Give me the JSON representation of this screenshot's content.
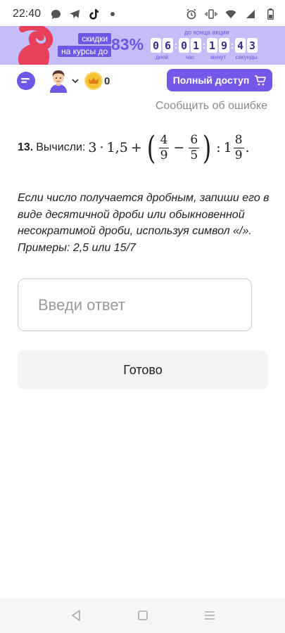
{
  "status_bar": {
    "time": "22:40",
    "icons_left": [
      "chat-bubble-icon",
      "telegram-icon",
      "tiktok-icon",
      "dot-icon"
    ],
    "icons_right": [
      "alarm-icon",
      "vibrate-icon",
      "wifi-icon",
      "signal-icon",
      "battery-icon"
    ]
  },
  "promo": {
    "label_line1": "скидки",
    "label_line2": "на курсы до",
    "percent": "83%",
    "until_label": "до конца акции",
    "timer": [
      {
        "digits": [
          "0",
          "6"
        ],
        "label": "дней"
      },
      {
        "digits": [
          "0",
          "1"
        ],
        "label": "час"
      },
      {
        "digits": [
          "1",
          "9"
        ],
        "label": "минут"
      },
      {
        "digits": [
          "4",
          "3"
        ],
        "label": "секунды"
      }
    ],
    "accent_color": "#6f55e8",
    "background_color": "#c4bdf7"
  },
  "header": {
    "coins": "0",
    "full_access_label": "Полный доступ",
    "accent_color": "#7357e8"
  },
  "report_link": "Сообщить об ошибке",
  "task": {
    "number": "13.",
    "label": "Вычисли:",
    "expr": {
      "a": "3",
      "dot": "·",
      "b": "1,5",
      "plus": "+",
      "f1_num": "4",
      "f1_den": "9",
      "minus": "−",
      "f2_num": "6",
      "f2_den": "5",
      "div": ":",
      "whole": "1",
      "f3_num": "8",
      "f3_den": "9",
      "end": "."
    }
  },
  "instruction": "Если число получается дробным, запиши его в виде десятичной дроби или обыкновенной несократимой дроби, используя символ «/». Примеры: 2,5 или 15/7",
  "answer": {
    "value": "",
    "placeholder": "Введи ответ"
  },
  "done_label": "Готово",
  "navbar": {
    "buttons": [
      "back-icon",
      "home-icon",
      "menu-icon"
    ]
  }
}
